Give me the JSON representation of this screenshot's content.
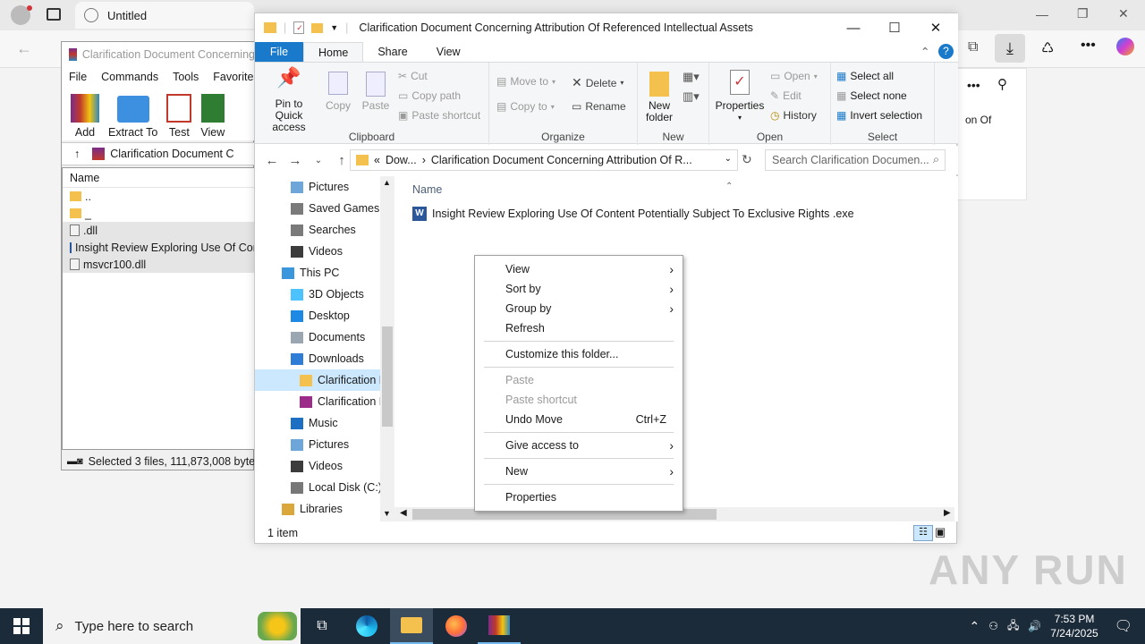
{
  "browser": {
    "tab_title": "Untitled",
    "side_text": "on Of"
  },
  "winrar": {
    "title": "Clarification Document Concerning",
    "menu": [
      "File",
      "Commands",
      "Tools",
      "Favorites"
    ],
    "toolbar": [
      "Add",
      "Extract To",
      "Test",
      "View"
    ],
    "address": "Clarification Document C",
    "column_name": "Name",
    "files": [
      {
        "name": "..",
        "icon": "folder-icon"
      },
      {
        "name": "_",
        "icon": "folder-icon"
      },
      {
        "name": ".dll",
        "icon": "dll-file-icon"
      },
      {
        "name": "Insight Review Exploring Use Of Con",
        "icon": "exe-file-icon"
      },
      {
        "name": "msvcr100.dll",
        "icon": "dll-file-icon"
      }
    ],
    "status": "Selected 3 files, 111,873,008 byte"
  },
  "explorer": {
    "title": "Clarification Document Concerning Attribution Of Referenced Intellectual Assets",
    "tabs": [
      "File",
      "Home",
      "Share",
      "View"
    ],
    "ribbon": {
      "clipboard": {
        "label": "Clipboard",
        "pin": "Pin to Quick access",
        "copy": "Copy",
        "paste": "Paste",
        "cut": "Cut",
        "copy_path": "Copy path",
        "paste_shortcut": "Paste shortcut"
      },
      "organize": {
        "label": "Organize",
        "move_to": "Move to",
        "copy_to": "Copy to",
        "delete": "Delete",
        "rename": "Rename"
      },
      "new": {
        "label": "New",
        "new_folder": "New folder"
      },
      "open": {
        "label": "Open",
        "properties": "Properties",
        "open": "Open",
        "edit": "Edit",
        "history": "History"
      },
      "select": {
        "label": "Select",
        "select_all": "Select all",
        "select_none": "Select none",
        "invert": "Invert selection"
      }
    },
    "address": {
      "prefix": "«",
      "part1": "Dow...",
      "part2": "Clarification Document Concerning Attribution Of R..."
    },
    "search_placeholder": "Search Clarification Documen...",
    "tree": [
      {
        "label": "Pictures",
        "icon": "pictures-icon",
        "indent": 1
      },
      {
        "label": "Saved Games",
        "icon": "saved-games-icon",
        "indent": 1
      },
      {
        "label": "Searches",
        "icon": "search-icon",
        "indent": 1
      },
      {
        "label": "Videos",
        "icon": "videos-icon",
        "indent": 1
      },
      {
        "label": "This PC",
        "icon": "computer-icon",
        "indent": 0
      },
      {
        "label": "3D Objects",
        "icon": "3d-objects-icon",
        "indent": 1
      },
      {
        "label": "Desktop",
        "icon": "desktop-icon",
        "indent": 1
      },
      {
        "label": "Documents",
        "icon": "documents-icon",
        "indent": 1
      },
      {
        "label": "Downloads",
        "icon": "downloads-icon",
        "indent": 1
      },
      {
        "label": "Clarification D",
        "icon": "folder-icon",
        "indent": 2,
        "selected": true
      },
      {
        "label": "Clarification D",
        "icon": "winrar-archive-icon",
        "indent": 2
      },
      {
        "label": "Music",
        "icon": "music-icon",
        "indent": 1
      },
      {
        "label": "Pictures",
        "icon": "pictures-icon",
        "indent": 1
      },
      {
        "label": "Videos",
        "icon": "videos-icon",
        "indent": 1
      },
      {
        "label": "Local Disk (C:)",
        "icon": "disk-icon",
        "indent": 1
      },
      {
        "label": "Libraries",
        "icon": "libraries-icon",
        "indent": 0
      }
    ],
    "column_name": "Name",
    "file": "Insight Review Exploring Use Of Content Potentially Subject To Exclusive Rights  .exe",
    "status": "1 item"
  },
  "context_menu": {
    "view": "View",
    "sort_by": "Sort by",
    "group_by": "Group by",
    "refresh": "Refresh",
    "customize": "Customize this folder...",
    "paste": "Paste",
    "paste_shortcut": "Paste shortcut",
    "undo_move": "Undo Move",
    "undo_shortcut": "Ctrl+Z",
    "give_access": "Give access to",
    "new": "New",
    "properties": "Properties"
  },
  "taskbar": {
    "search_placeholder": "Type here to search",
    "time": "7:53 PM",
    "date": "7/24/2025"
  },
  "watermark": "ANY RUN",
  "colors": {
    "accent": "#1979ca",
    "taskbar": "#1c2b3a",
    "selection": "#cce8ff"
  }
}
